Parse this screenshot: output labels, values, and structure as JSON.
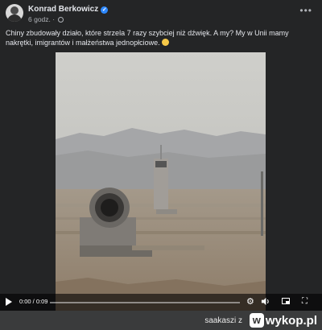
{
  "post": {
    "author": "Konrad Berkowicz",
    "verified_icon": "verified-badge-icon",
    "time": "6 godz.",
    "caption": "Chiny zbudowały działo, które strzela 7 razy szybciej niż dźwięk. A my? My w Unii mamy nakrętki, imigrantów i małżeństwa jednopłciowe.",
    "more_icon": "more-options-icon"
  },
  "video": {
    "time_label": "0:00 / 0:09",
    "progress": 0.0,
    "icons": [
      "play-icon",
      "settings-gear-icon",
      "volume-icon",
      "picture-in-picture-icon",
      "fullscreen-icon"
    ]
  },
  "footer": {
    "username": "saakaszi",
    "separator": "z",
    "site": "wykop.pl",
    "site_logo_letter": "w"
  },
  "colors": {
    "card_bg": "#242526",
    "page_bg": "#3a3b3c",
    "text_primary": "#e4e6eb",
    "text_secondary": "#b0b3b8",
    "verified": "#2d88ff"
  }
}
